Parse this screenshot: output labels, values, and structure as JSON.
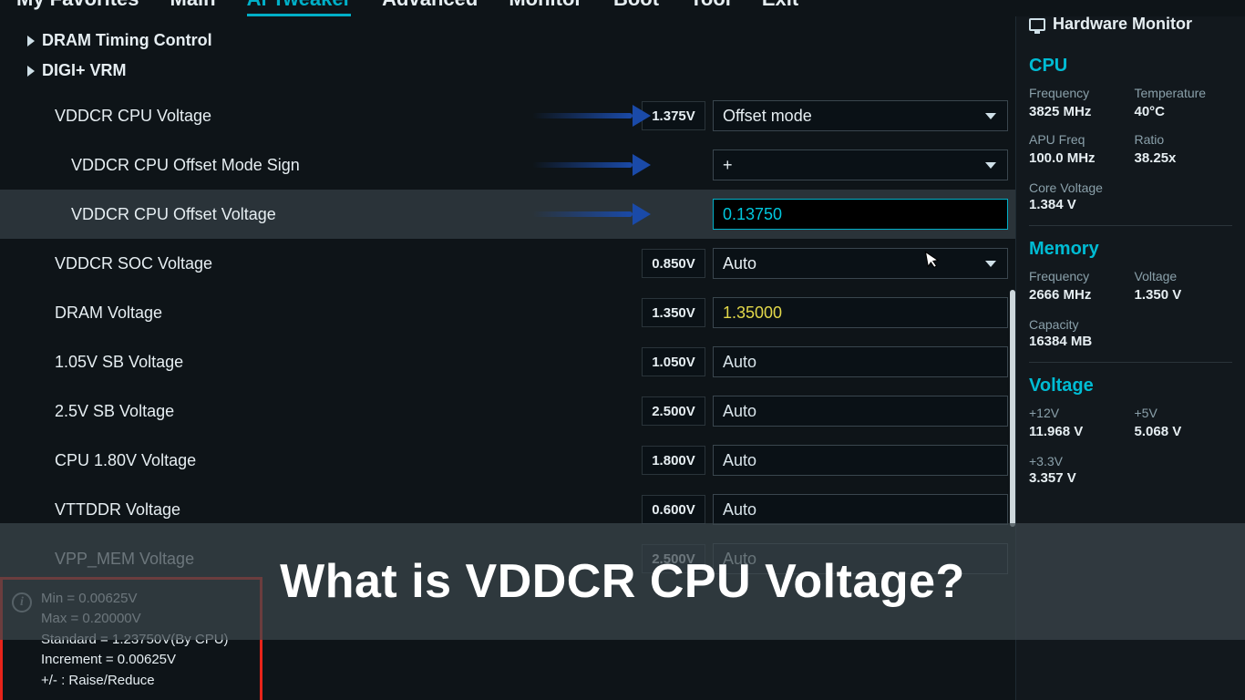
{
  "topmenu": {
    "items": [
      "My Favorites",
      "Main",
      "Ai Tweaker",
      "Advanced",
      "Monitor",
      "Boot",
      "Tool",
      "Exit"
    ],
    "active_index": 2
  },
  "tree": [
    {
      "label": "DRAM Timing Control"
    },
    {
      "label": "DIGI+ VRM"
    }
  ],
  "rows": [
    {
      "label": "VDDCR CPU Voltage",
      "curval": "1.375V",
      "field": "Offset mode",
      "type": "select",
      "indent": false,
      "arrow": true
    },
    {
      "label": "VDDCR CPU Offset Mode Sign",
      "curval": "",
      "field": "+",
      "type": "select",
      "indent": true,
      "arrow": true
    },
    {
      "label": "VDDCR CPU Offset Voltage",
      "curval": "",
      "field": "0.13750",
      "type": "input-active",
      "indent": true,
      "arrow": true,
      "highlight": true
    },
    {
      "label": "VDDCR SOC Voltage",
      "curval": "0.850V",
      "field": "Auto",
      "type": "select",
      "indent": false
    },
    {
      "label": "DRAM Voltage",
      "curval": "1.350V",
      "field": "1.35000",
      "type": "input-yellow",
      "indent": false
    },
    {
      "label": "1.05V SB Voltage",
      "curval": "1.050V",
      "field": "Auto",
      "type": "readonly",
      "indent": false
    },
    {
      "label": "2.5V SB Voltage",
      "curval": "2.500V",
      "field": "Auto",
      "type": "readonly",
      "indent": false
    },
    {
      "label": "CPU 1.80V Voltage",
      "curval": "1.800V",
      "field": "Auto",
      "type": "readonly",
      "indent": false
    },
    {
      "label": "VTTDDR Voltage",
      "curval": "0.600V",
      "field": "Auto",
      "type": "readonly",
      "indent": false
    },
    {
      "label": "VPP_MEM Voltage",
      "curval": "2.500V",
      "field": "Auto",
      "type": "readonly",
      "indent": false
    }
  ],
  "infobox": {
    "lines": [
      "Min = 0.00625V",
      "Max = 0.20000V",
      "Standard = 1.23750V(By CPU)",
      "Increment = 0.00625V",
      "+/- : Raise/Reduce"
    ]
  },
  "sidebar": {
    "header": "Hardware Monitor",
    "cpu": {
      "title": "CPU",
      "frequency_label": "Frequency",
      "frequency": "3825 MHz",
      "temperature_label": "Temperature",
      "temperature": "40°C",
      "apu_label": "APU Freq",
      "apu": "100.0 MHz",
      "ratio_label": "Ratio",
      "ratio": "38.25x",
      "corev_label": "Core Voltage",
      "corev": "1.384 V"
    },
    "memory": {
      "title": "Memory",
      "frequency_label": "Frequency",
      "frequency": "2666 MHz",
      "voltage_label": "Voltage",
      "voltage": "1.350 V",
      "capacity_label": "Capacity",
      "capacity": "16384 MB"
    },
    "voltage": {
      "title": "Voltage",
      "v12_label": "+12V",
      "v12": "11.968 V",
      "v5_label": "+5V",
      "v5": "5.068 V",
      "v33_label": "+3.3V",
      "v33": "3.357 V"
    }
  },
  "overlay_caption": "What is VDDCR CPU Voltage?"
}
